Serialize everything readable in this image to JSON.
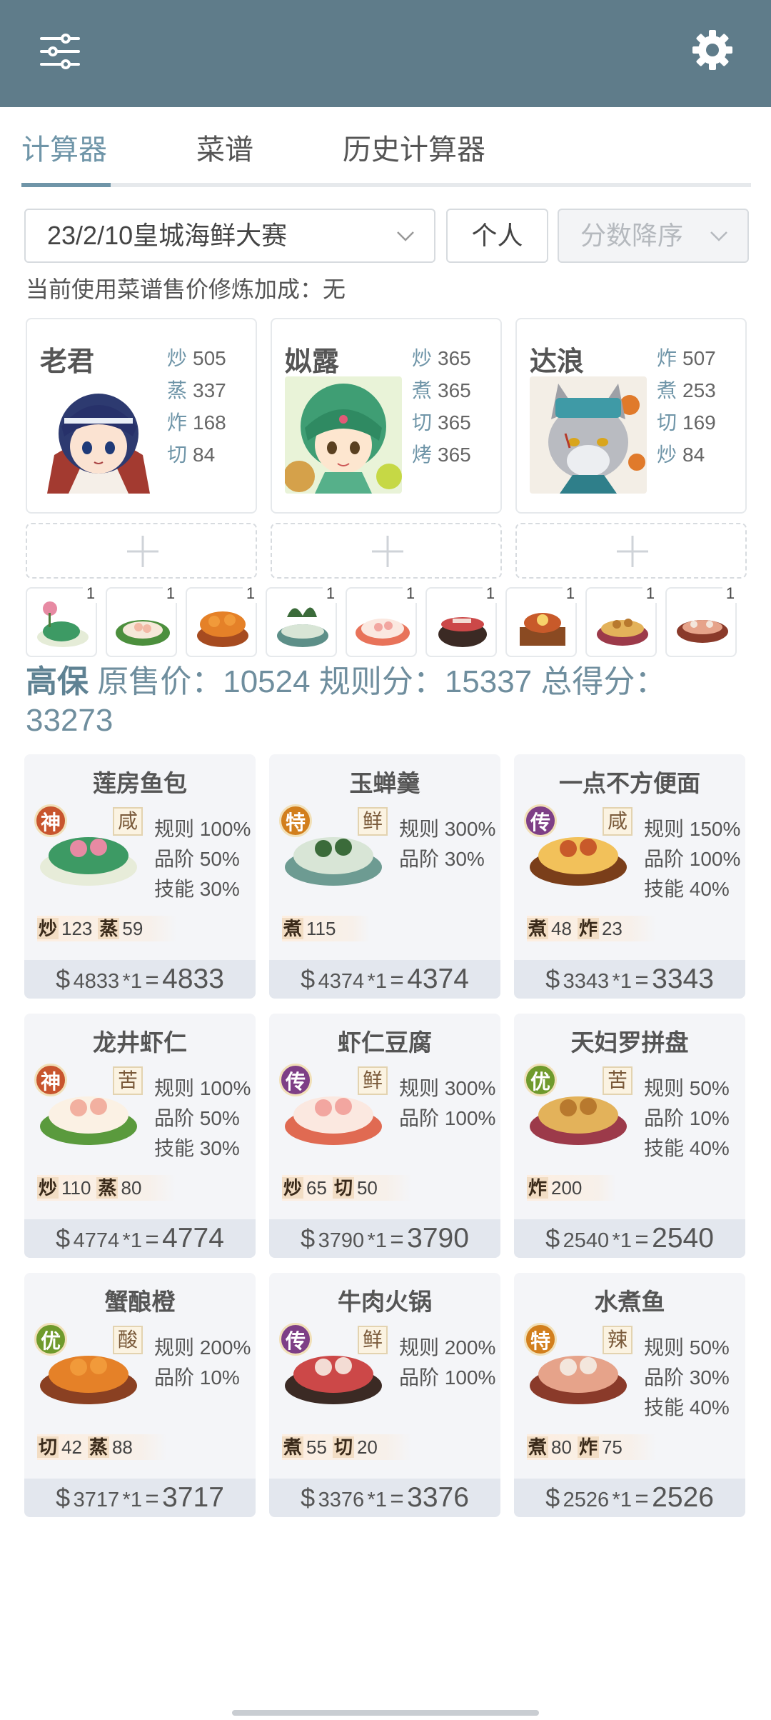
{
  "header": {
    "menu_icon": "sliders-icon",
    "settings_icon": "gear-icon",
    "color": "#5f7c8a"
  },
  "tabs": [
    {
      "label": "计算器",
      "active": true
    },
    {
      "label": "菜谱",
      "active": false
    },
    {
      "label": "历史计算器",
      "active": false
    }
  ],
  "filters": {
    "contest": "23/2/10皇城海鲜大赛",
    "mode": "个人",
    "sort": "分数降序"
  },
  "bonus_text": "当前使用菜谱售价修炼加成：无",
  "chefs": [
    {
      "name": "老君",
      "stats": [
        {
          "k": "炒",
          "v": "505"
        },
        {
          "k": "蒸",
          "v": "337"
        },
        {
          "k": "炸",
          "v": "168"
        },
        {
          "k": "切",
          "v": "84"
        }
      ]
    },
    {
      "name": "姒露",
      "stats": [
        {
          "k": "炒",
          "v": "365"
        },
        {
          "k": "煮",
          "v": "365"
        },
        {
          "k": "切",
          "v": "365"
        },
        {
          "k": "烤",
          "v": "365"
        }
      ]
    },
    {
      "name": "达浪",
      "stats": [
        {
          "k": "炸",
          "v": "507"
        },
        {
          "k": "煮",
          "v": "253"
        },
        {
          "k": "切",
          "v": "169"
        },
        {
          "k": "炒",
          "v": "84"
        }
      ]
    }
  ],
  "thumb_counts": [
    "1",
    "1",
    "1",
    "1",
    "1",
    "1",
    "1",
    "1",
    "1"
  ],
  "summary": {
    "chef": "高保",
    "price_label": "原售价：",
    "price": "10524",
    "rule_label": "规则分：",
    "rule": "15337",
    "total_label": "总得分：",
    "total": "33273"
  },
  "dishes": [
    {
      "name": "莲房鱼包",
      "rarity": "神",
      "taste": "咸",
      "mods": [
        "规则 100%",
        "品阶 50%",
        "技能 30%"
      ],
      "skills": [
        {
          "k": "炒",
          "v": "123"
        },
        {
          "k": "蒸",
          "v": "59"
        }
      ],
      "base": "4833",
      "mul": "*1",
      "total": "4833"
    },
    {
      "name": "玉蝉羹",
      "rarity": "特",
      "taste": "鲜",
      "mods": [
        "规则 300%",
        "品阶 30%"
      ],
      "skills": [
        {
          "k": "煮",
          "v": "115"
        }
      ],
      "base": "4374",
      "mul": "*1",
      "total": "4374"
    },
    {
      "name": "一点不方便面",
      "rarity": "传",
      "taste": "咸",
      "mods": [
        "规则 150%",
        "品阶 100%",
        "技能 40%"
      ],
      "skills": [
        {
          "k": "煮",
          "v": "48"
        },
        {
          "k": "炸",
          "v": "23"
        }
      ],
      "base": "3343",
      "mul": "*1",
      "total": "3343"
    },
    {
      "name": "龙井虾仁",
      "rarity": "神",
      "taste": "苦",
      "mods": [
        "规则 100%",
        "品阶 50%",
        "技能 30%"
      ],
      "skills": [
        {
          "k": "炒",
          "v": "110"
        },
        {
          "k": "蒸",
          "v": "80"
        }
      ],
      "base": "4774",
      "mul": "*1",
      "total": "4774"
    },
    {
      "name": "虾仁豆腐",
      "rarity": "传",
      "taste": "鲜",
      "mods": [
        "规则 300%",
        "品阶 100%"
      ],
      "skills": [
        {
          "k": "炒",
          "v": "65"
        },
        {
          "k": "切",
          "v": "50"
        }
      ],
      "base": "3790",
      "mul": "*1",
      "total": "3790"
    },
    {
      "name": "天妇罗拼盘",
      "rarity": "优",
      "taste": "苦",
      "mods": [
        "规则 50%",
        "品阶 10%",
        "技能 40%"
      ],
      "skills": [
        {
          "k": "炸",
          "v": "200"
        }
      ],
      "base": "2540",
      "mul": "*1",
      "total": "2540"
    },
    {
      "name": "蟹酿橙",
      "rarity": "优",
      "taste": "酸",
      "mods": [
        "规则 200%",
        "品阶 10%"
      ],
      "skills": [
        {
          "k": "切",
          "v": "42"
        },
        {
          "k": "蒸",
          "v": "88"
        }
      ],
      "base": "3717",
      "mul": "*1",
      "total": "3717"
    },
    {
      "name": "牛肉火锅",
      "rarity": "传",
      "taste": "鲜",
      "mods": [
        "规则 200%",
        "品阶 100%"
      ],
      "skills": [
        {
          "k": "煮",
          "v": "55"
        },
        {
          "k": "切",
          "v": "20"
        }
      ],
      "base": "3376",
      "mul": "*1",
      "total": "3376"
    },
    {
      "name": "水煮鱼",
      "rarity": "特",
      "taste": "辣",
      "mods": [
        "规则 50%",
        "品阶 30%",
        "技能 40%"
      ],
      "skills": [
        {
          "k": "煮",
          "v": "80"
        },
        {
          "k": "炸",
          "v": "75"
        }
      ],
      "base": "2526",
      "mul": "*1",
      "total": "2526"
    }
  ],
  "rarity_colors": {
    "神": "#c8552e",
    "特": "#d27f1d",
    "传": "#7e3f86",
    "优": "#6f9a2c"
  },
  "currency": "$",
  "equals": "="
}
